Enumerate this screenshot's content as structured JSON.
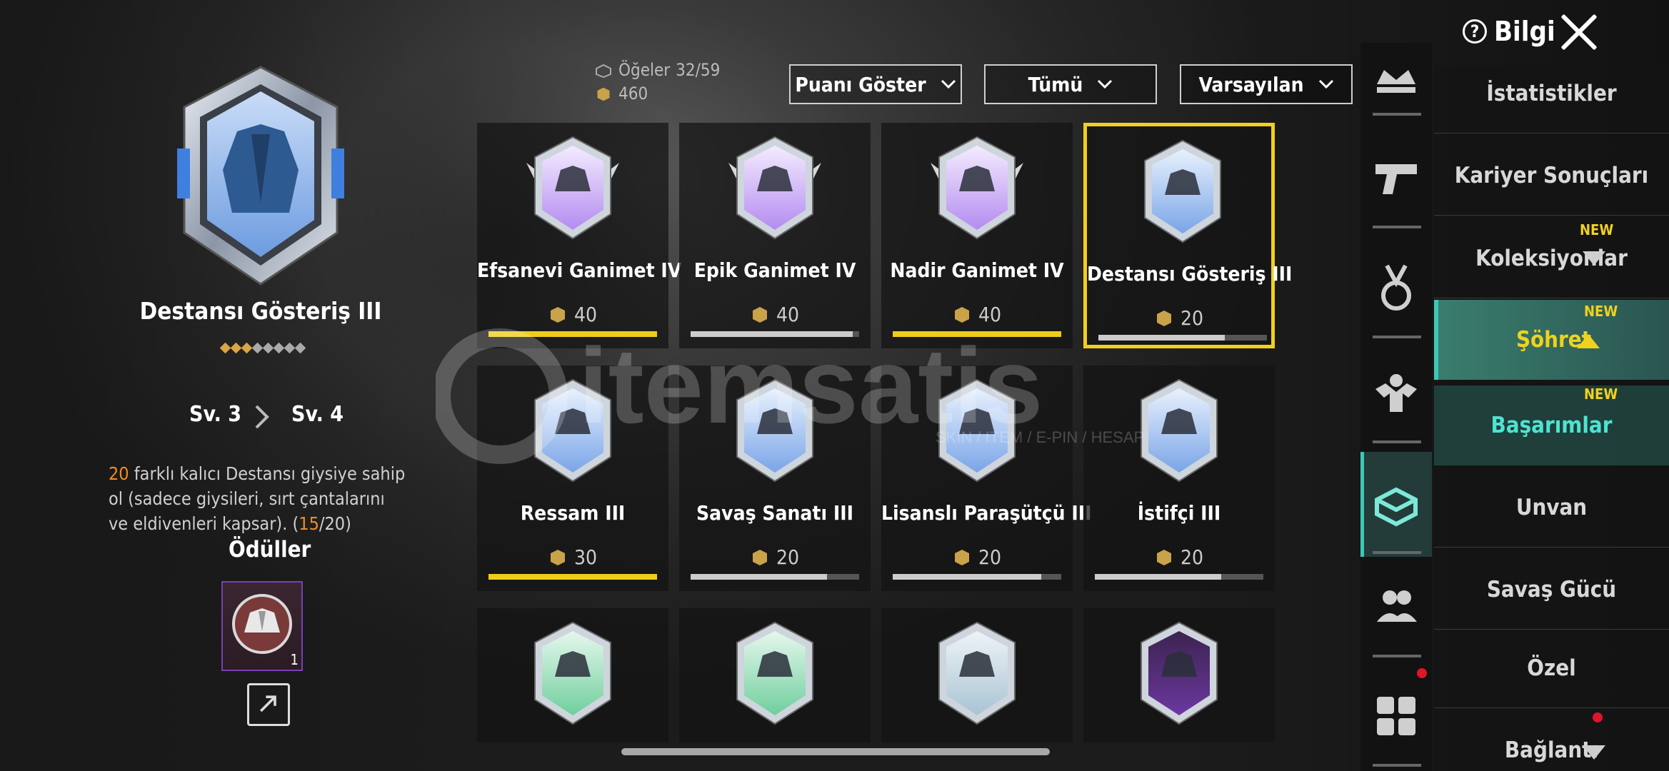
{
  "header": {
    "info_label": "Bilgi"
  },
  "detail": {
    "title": "Destansı Gösteriş III",
    "level_from": "Sv. 3",
    "level_to": "Sv. 4",
    "desc_count": "20",
    "desc_text": " farklı kalıcı Destansı giysiye sahip ol (sadece giysileri, sırt çantalarını ve eldivenleri kapsar). (",
    "progress_done": "15",
    "progress_total": "/20)",
    "rewards_label": "Ödüller",
    "reward_count": "1",
    "stars_total": 8,
    "stars_filled": 3
  },
  "counters": {
    "items_label": "Öğeler",
    "items_value": "32/59",
    "points": "460"
  },
  "filters": {
    "sort_points": "Puanı Göster",
    "category": "Tümü",
    "order": "Varsayılan"
  },
  "cards": [
    {
      "name": "Efsanevi Ganimet IV",
      "points": "40",
      "progress": 1.0,
      "tier": "purple",
      "icon": "tuxedo-icon"
    },
    {
      "name": "Epik Ganimet IV",
      "points": "40",
      "progress": 0.96,
      "tier": "purple",
      "icon": "tuxedo-icon"
    },
    {
      "name": "Nadir Ganimet IV",
      "points": "40",
      "progress": 1.0,
      "tier": "purple",
      "icon": "tuxedo-icon"
    },
    {
      "name": "Destansı Gösteriş III",
      "points": "20",
      "progress": 0.75,
      "tier": "blue",
      "icon": "jacket-icon",
      "selected": true
    },
    {
      "name": "Ressam III",
      "points": "30",
      "progress": 1.0,
      "tier": "blue",
      "icon": "crosshair-rifle-icon"
    },
    {
      "name": "Savaş Sanatı III",
      "points": "20",
      "progress": 0.81,
      "tier": "blue",
      "icon": "claw-marks-icon"
    },
    {
      "name": "Lisanslı Paraşütçü III",
      "points": "20",
      "progress": 0.88,
      "tier": "blue",
      "icon": "parachute-icon"
    },
    {
      "name": "İstifçi III",
      "points": "20",
      "progress": 0.75,
      "tier": "blue",
      "icon": "locker-icon"
    },
    {
      "name": "",
      "points": "",
      "progress": null,
      "tier": "green",
      "icon": "dance-pose-icon"
    },
    {
      "name": "",
      "points": "",
      "progress": null,
      "tier": "green",
      "icon": "dance-pose-icon"
    },
    {
      "name": "",
      "points": "",
      "progress": null,
      "tier": "silver",
      "icon": "dance-pose-icon"
    },
    {
      "name": "",
      "points": "",
      "progress": null,
      "tier": "dark-purple",
      "icon": "crystal-icon"
    }
  ],
  "nav": {
    "icons": [
      "crown-icon",
      "pistol-icon",
      "medal-icon",
      "muscle-icon",
      "collection-box-icon",
      "friends-icon",
      "grid-apps-icon"
    ],
    "menu": [
      "İstatistikler",
      "Kariyer Sonuçları",
      "Koleksiyonlar",
      "Şöhret",
      "Başarımlar",
      "Unvan",
      "Savaş Gücü",
      "Özel",
      "Bağlantı"
    ],
    "new_label": "NEW"
  },
  "watermark": {
    "brand": "itemsatis",
    "tagline": "SKIN / ITEM / E-PIN / HESAP"
  },
  "colors": {
    "accent_yellow": "#f2cf1e",
    "accent_teal": "#3cc8b5",
    "orange": "#f08b2a"
  }
}
